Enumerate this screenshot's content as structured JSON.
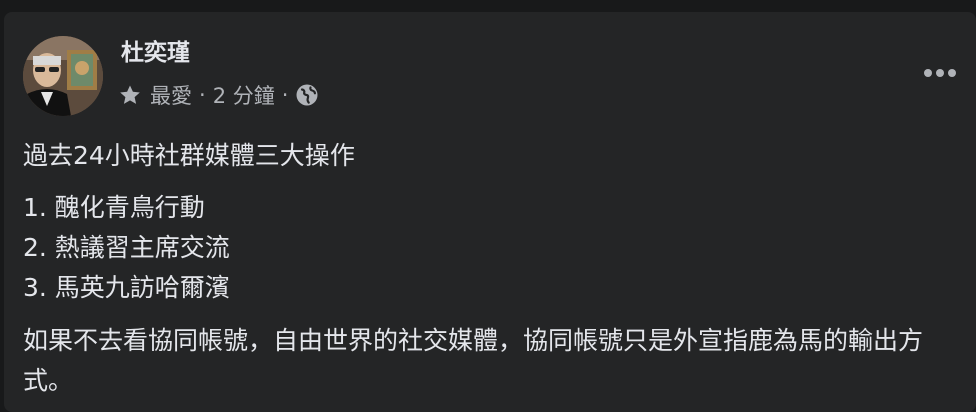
{
  "post": {
    "author": "杜奕瑾",
    "audience": "最愛",
    "separator": "·",
    "time": "2 分鐘",
    "icons": {
      "audience": "star-icon",
      "privacy": "globe-icon",
      "menu": "more-options-icon"
    },
    "paragraphs": [
      "過去24小時社群媒體三大操作",
      "如果不去看協同帳號，自由世界的社交媒體，協同帳號只是外宣指鹿為馬的輸出方式。"
    ],
    "list_items": [
      "1. 醜化青鳥行動",
      "2. 熱議習主席交流",
      "3. 馬英九訪哈爾濱"
    ]
  },
  "colors": {
    "page_background": "#18191a",
    "card_background": "#242526",
    "primary_text": "#e4e6eb",
    "secondary_text": "#b0b3b8"
  }
}
